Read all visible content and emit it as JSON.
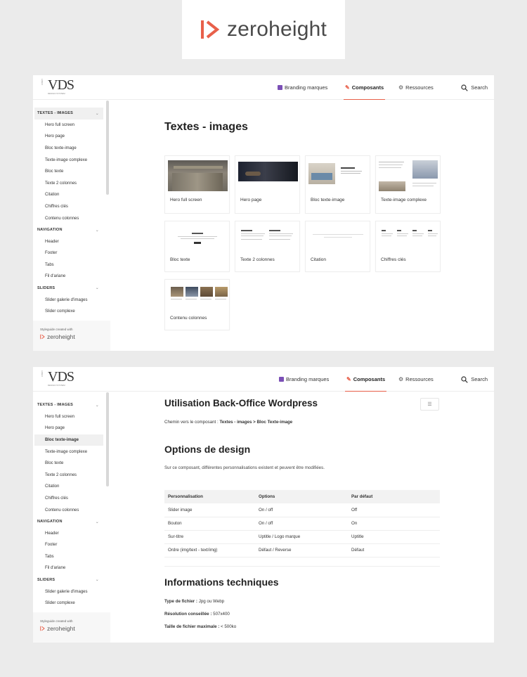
{
  "hero_logo": {
    "text": "zeroheight",
    "accent": "#e8604a"
  },
  "brand": {
    "name": "VDS"
  },
  "nav": {
    "branding": "Branding marques",
    "composants": "Composants",
    "ressources": "Ressources",
    "search": "Search"
  },
  "sidebar": {
    "sections": [
      {
        "label": "TEXTES - IMAGES",
        "items": [
          "Hero full screen",
          "Hero page",
          "Bloc texte-image",
          "Texte-image complexe",
          "Bloc texte",
          "Texte 2 colonnes",
          "Citation",
          "Chiffres clés",
          "Contenu colonnes"
        ]
      },
      {
        "label": "NAVIGATION",
        "items": [
          "Header",
          "Footer",
          "Tabs",
          "Fil d'ariane"
        ]
      },
      {
        "label": "SLIDERS",
        "items": [
          "Slider galerie d'images",
          "Slider complexe"
        ]
      }
    ],
    "footer_small": "Styleguide created with",
    "footer_brand": "zeroheight"
  },
  "page1": {
    "title": "Textes - images",
    "cards": [
      "Hero full screen",
      "Hero page",
      "Bloc texte-image",
      "Texte-image complexe",
      "Bloc texte",
      "Texte 2 colonnes",
      "Citation",
      "Chiffres clés",
      "Contenu colonnes"
    ]
  },
  "page2": {
    "title": "Utilisation Back-Office Wordpress",
    "path_prefix": "Chemin vers le composant :",
    "path_value": "Textes - images > Bloc Texte-image",
    "design_title": "Options de design",
    "design_text": "Sur ce composant, différentes personnalisations existent et peuvent être modifiées.",
    "table": {
      "headers": [
        "Personnalisation",
        "Options",
        "Par défaut"
      ],
      "rows": [
        [
          "Slider image",
          "On / off",
          "Off"
        ],
        [
          "Bouton",
          "On / off",
          "On"
        ],
        [
          "Sur-titre",
          "Uptitle / Logo marque",
          "Uptitle"
        ],
        [
          "Ordre (img/text - text/img)",
          "Défaut / Reverse",
          "Défaut"
        ]
      ]
    },
    "tech_title": "Informations techniques",
    "tech": [
      {
        "label": "Type de fichier :",
        "value": "Jpg ou Webp"
      },
      {
        "label": "Résolution conseillée :",
        "value": "507x400"
      },
      {
        "label": "Taille de fichier maximale :",
        "value": "< 500ko"
      }
    ]
  }
}
